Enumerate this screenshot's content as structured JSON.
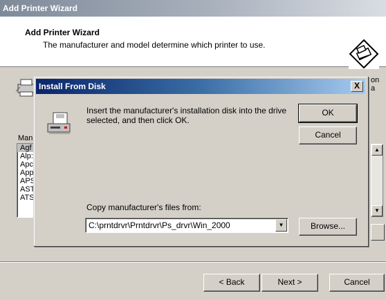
{
  "wizard": {
    "window_title": "Add Printer Wizard",
    "header_title": "Add Printer Wizard",
    "header_subtitle": "The manufacturer and model determine which printer to use.",
    "behind_partial_text": "on\na",
    "manufacturers_label_partial": "Manu",
    "manufacturer_list_partial": [
      "Agf",
      "Alp:",
      "Apc",
      "App",
      "APS",
      "AST",
      "ATS"
    ],
    "back_label": "< Back",
    "next_label": "Next >",
    "cancel_label": "Cancel"
  },
  "dialog": {
    "title": "Install From Disk",
    "close_label": "X",
    "message": "Insert the manufacturer's installation disk into the drive selected, and then click OK.",
    "ok_label": "OK",
    "cancel_label": "Cancel",
    "copy_label": "Copy manufacturer's files from:",
    "copy_path": "C:\\prntdrvr\\Prntdrvr\\Ps_drvr\\Win_2000",
    "browse_label": "Browse..."
  }
}
